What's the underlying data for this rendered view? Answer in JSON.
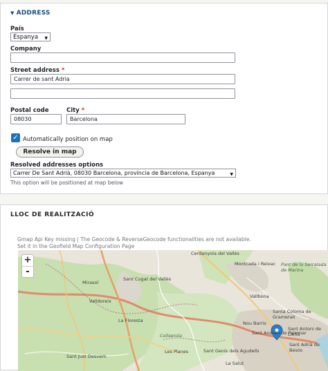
{
  "address": {
    "legend": "ADDRESS",
    "country_label": "País",
    "country_value": "Espanya",
    "company_label": "Company",
    "company_value": "",
    "street_label": "Street address",
    "street_value": "Carrer de sant Adria",
    "street2_value": "",
    "postal_label": "Postal code",
    "postal_value": "08030",
    "city_label": "City",
    "city_value": "Barcelona",
    "required_mark": "*",
    "auto_position_label": "Automatically position on map",
    "resolve_button": "Resolve in map",
    "resolved_label": "Resolved addresses options",
    "resolved_value": "Carrer De Sant Adrià, 08030 Barcelona, província de Barcelona, Espanya",
    "resolved_description": "This option will be positioned at map below"
  },
  "lloc": {
    "legend": "LLOC DE REALITZACIÓ",
    "notice_line1": "Gmap Api Key missing | The Geocode & ReverseGeocode functionalities are not available.",
    "notice_line2": "Set it in the Geofield Map Configuration Page"
  },
  "map": {
    "zoom_in": "+",
    "zoom_out": "-",
    "labels": [
      {
        "text": "Cerdanyola del Vallès",
        "cls": ""
      },
      {
        "text": "Mirasol",
        "cls": ""
      },
      {
        "text": "Sant Cugat del Vallès",
        "cls": ""
      },
      {
        "text": "Valldoreix",
        "cls": ""
      },
      {
        "text": "La Floresta",
        "cls": ""
      },
      {
        "text": "Montcada i Reixac",
        "cls": ""
      },
      {
        "text": "Parc de la Serralada de Marina",
        "cls": "green"
      },
      {
        "text": "Vallbona",
        "cls": ""
      },
      {
        "text": "Santa Coloma de Gramenet",
        "cls": ""
      },
      {
        "text": "Nou Barris",
        "cls": ""
      },
      {
        "text": "Sant Andreu de Palomar",
        "cls": ""
      },
      {
        "text": "Sant Antoni de Llefià",
        "cls": ""
      },
      {
        "text": "Sant Adrià de Besòs",
        "cls": ""
      },
      {
        "text": "Sant Just Desvern",
        "cls": ""
      },
      {
        "text": "Sant Genís dels Agudells",
        "cls": ""
      },
      {
        "text": "Les Planes",
        "cls": ""
      },
      {
        "text": "La Salut",
        "cls": ""
      },
      {
        "text": "Collserola",
        "cls": "green"
      }
    ],
    "accent_color": "#1e73be",
    "marker_color": "#2a7ec8"
  }
}
